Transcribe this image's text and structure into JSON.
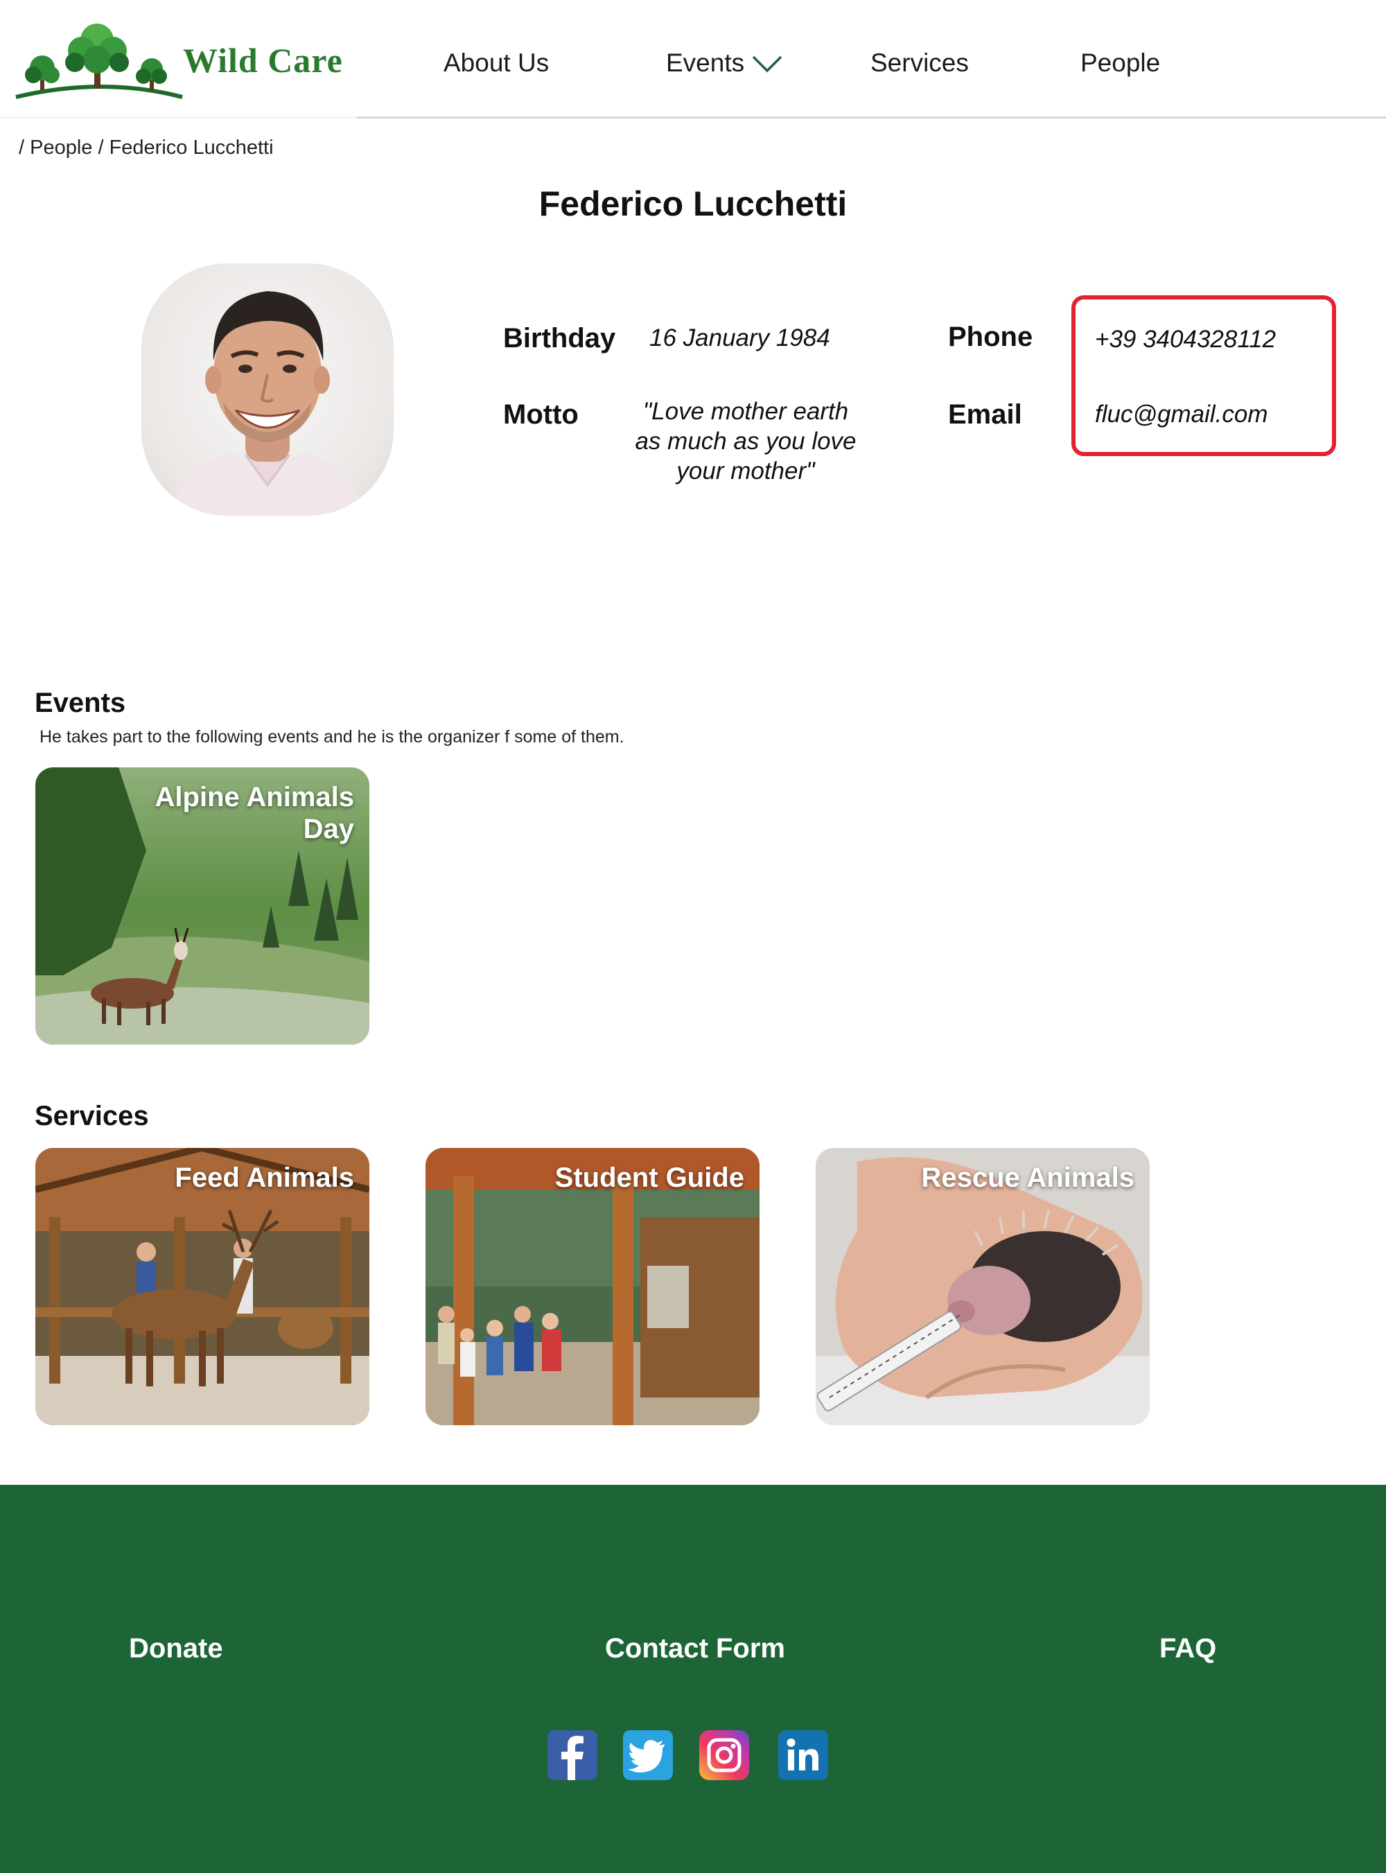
{
  "brand": {
    "name": "Wild Care"
  },
  "nav": {
    "about": "About Us",
    "events": "Events",
    "services": "Services",
    "people": "People"
  },
  "breadcrumb": "/ People / Federico Lucchetti",
  "profile": {
    "name": "Federico Lucchetti",
    "birthday_label": "Birthday",
    "birthday": "16 January 1984",
    "motto_label": "Motto",
    "motto": "\"Love mother earth as much as you love your mother\"",
    "phone_label": "Phone",
    "phone": "+39 3404328112",
    "email_label": "Email",
    "email": "fluc@gmail.com"
  },
  "events_section": {
    "title": "Events",
    "description": "He takes part to the following events and he is the organizer f some of them.",
    "cards": [
      {
        "title": "Alpine Animals Day"
      }
    ]
  },
  "services_section": {
    "title": "Services",
    "cards": [
      {
        "title": "Feed Animals"
      },
      {
        "title": "Student Guide"
      },
      {
        "title": "Rescue Animals"
      }
    ]
  },
  "footer": {
    "donate": "Donate",
    "contact": "Contact Form",
    "faq": "FAQ"
  },
  "social": [
    "facebook-icon",
    "twitter-icon",
    "instagram-icon",
    "linkedin-icon"
  ],
  "colors": {
    "brand_green": "#2a7a2e",
    "footer_green": "#1d6536",
    "highlight_red": "#e32131"
  }
}
